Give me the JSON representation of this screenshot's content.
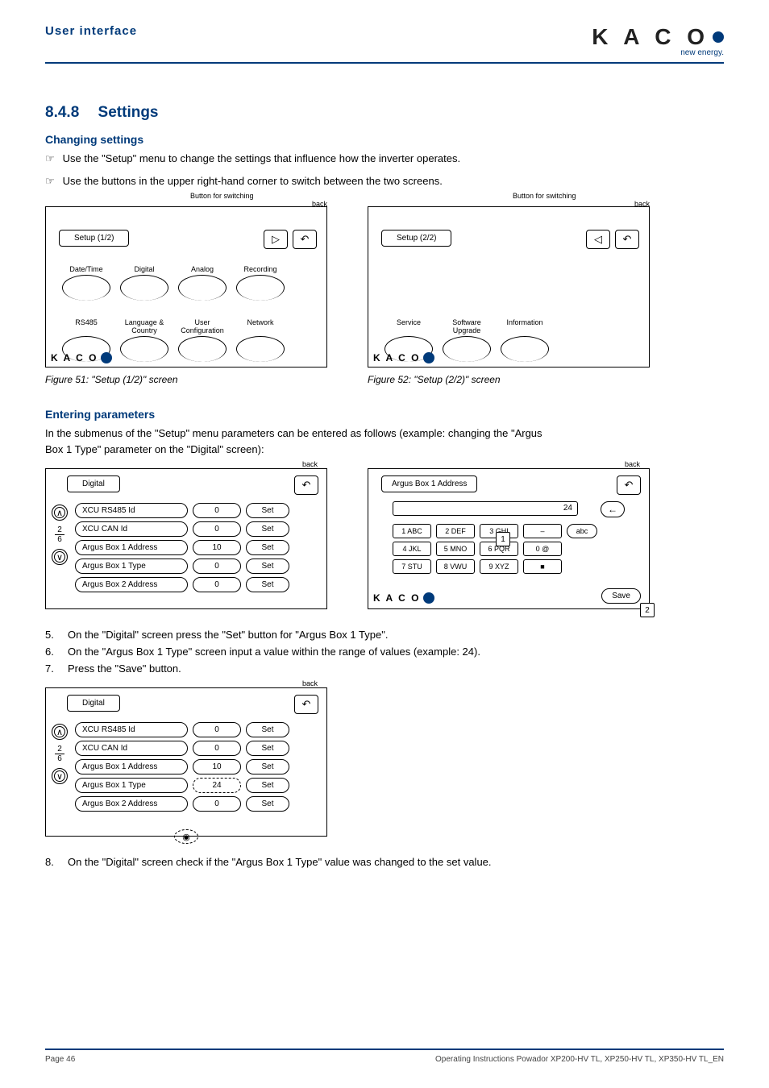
{
  "header": {
    "section": "User interface",
    "logo": "K A C O",
    "logosub": "new energy."
  },
  "heading": {
    "num": "8.4.8",
    "title": "Settings"
  },
  "changing": {
    "title": "Changing settings",
    "b1": "Use the \"Setup\" menu to change the settings that influence how the inverter operates.",
    "b2": "Use the buttons in the upper right-hand corner to switch between the two screens."
  },
  "panel1": {
    "switchlabel": "Button for switching",
    "back": "back",
    "title": "Setup (1/2)",
    "row1": [
      "Date/Time",
      "Digital",
      "Analog",
      "Recording"
    ],
    "row2": [
      "RS485",
      "Language & Country",
      "User Configuration",
      "Network"
    ],
    "caption": "Figure 51:  \"Setup (1/2)\" screen"
  },
  "panel2": {
    "switchlabel": "Button for switching",
    "back": "back",
    "title": "Setup (2/2)",
    "row": [
      "Service",
      "Software Upgrade",
      "Information"
    ],
    "caption": "Figure 52:  \"Setup (2/2)\" screen"
  },
  "entering": {
    "title": "Entering parameters",
    "intro": "In the submenus of the \"Setup\" menu parameters can be entered as follows (example: changing the \"Argus Box 1 Type\" parameter on the \"Digital\" screen):"
  },
  "digital1": {
    "title": "Digital",
    "back": "back",
    "frac_top": "2",
    "frac_bot": "6",
    "rows": [
      {
        "name": "XCU RS485 Id",
        "val": "0",
        "set": "Set"
      },
      {
        "name": "XCU CAN Id",
        "val": "0",
        "set": "Set"
      },
      {
        "name": "Argus Box 1 Address",
        "val": "10",
        "set": "Set"
      },
      {
        "name": "Argus Box 1 Type",
        "val": "0",
        "set": "Set"
      },
      {
        "name": "Argus Box 2 Address",
        "val": "0",
        "set": "Set"
      }
    ]
  },
  "keypad": {
    "title": "Argus Box 1 Address",
    "back": "back",
    "display": "24",
    "keys": [
      [
        "1 ABC",
        "2 DEF",
        "3 GHI",
        "–",
        "abc"
      ],
      [
        "4 JKL",
        "5 MNO",
        "6 PQR",
        "0 @",
        ""
      ],
      [
        "7 STU",
        "8 VWU",
        "9 XYZ",
        "■",
        ""
      ]
    ],
    "save": "Save",
    "call1": "1",
    "call2": "2"
  },
  "steps1": {
    "s5": "On the \"Digital\" screen press the \"Set\" button for \"Argus Box 1 Type\".",
    "s6": "On the \"Argus Box 1 Type\" screen input a value within the range of values (example: 24).",
    "s7": "Press the \"Save\" button."
  },
  "digital2": {
    "title": "Digital",
    "back": "back",
    "frac_top": "2",
    "frac_bot": "6",
    "rows": [
      {
        "name": "XCU RS485 Id",
        "val": "0",
        "set": "Set"
      },
      {
        "name": "XCU CAN Id",
        "val": "0",
        "set": "Set"
      },
      {
        "name": "Argus Box 1 Address",
        "val": "10",
        "set": "Set"
      },
      {
        "name": "Argus Box 1 Type",
        "val": "24",
        "set": "Set"
      },
      {
        "name": "Argus Box 2 Address",
        "val": "0",
        "set": "Set"
      }
    ]
  },
  "steps2": {
    "s8": "On the \"Digital\" screen check if the \"Argus Box 1 Type\" value was changed to the set value."
  },
  "footer": {
    "page": "Page 46",
    "doc": "Operating Instructions Powador XP200-HV TL, XP250-HV TL, XP350-HV TL_EN"
  }
}
